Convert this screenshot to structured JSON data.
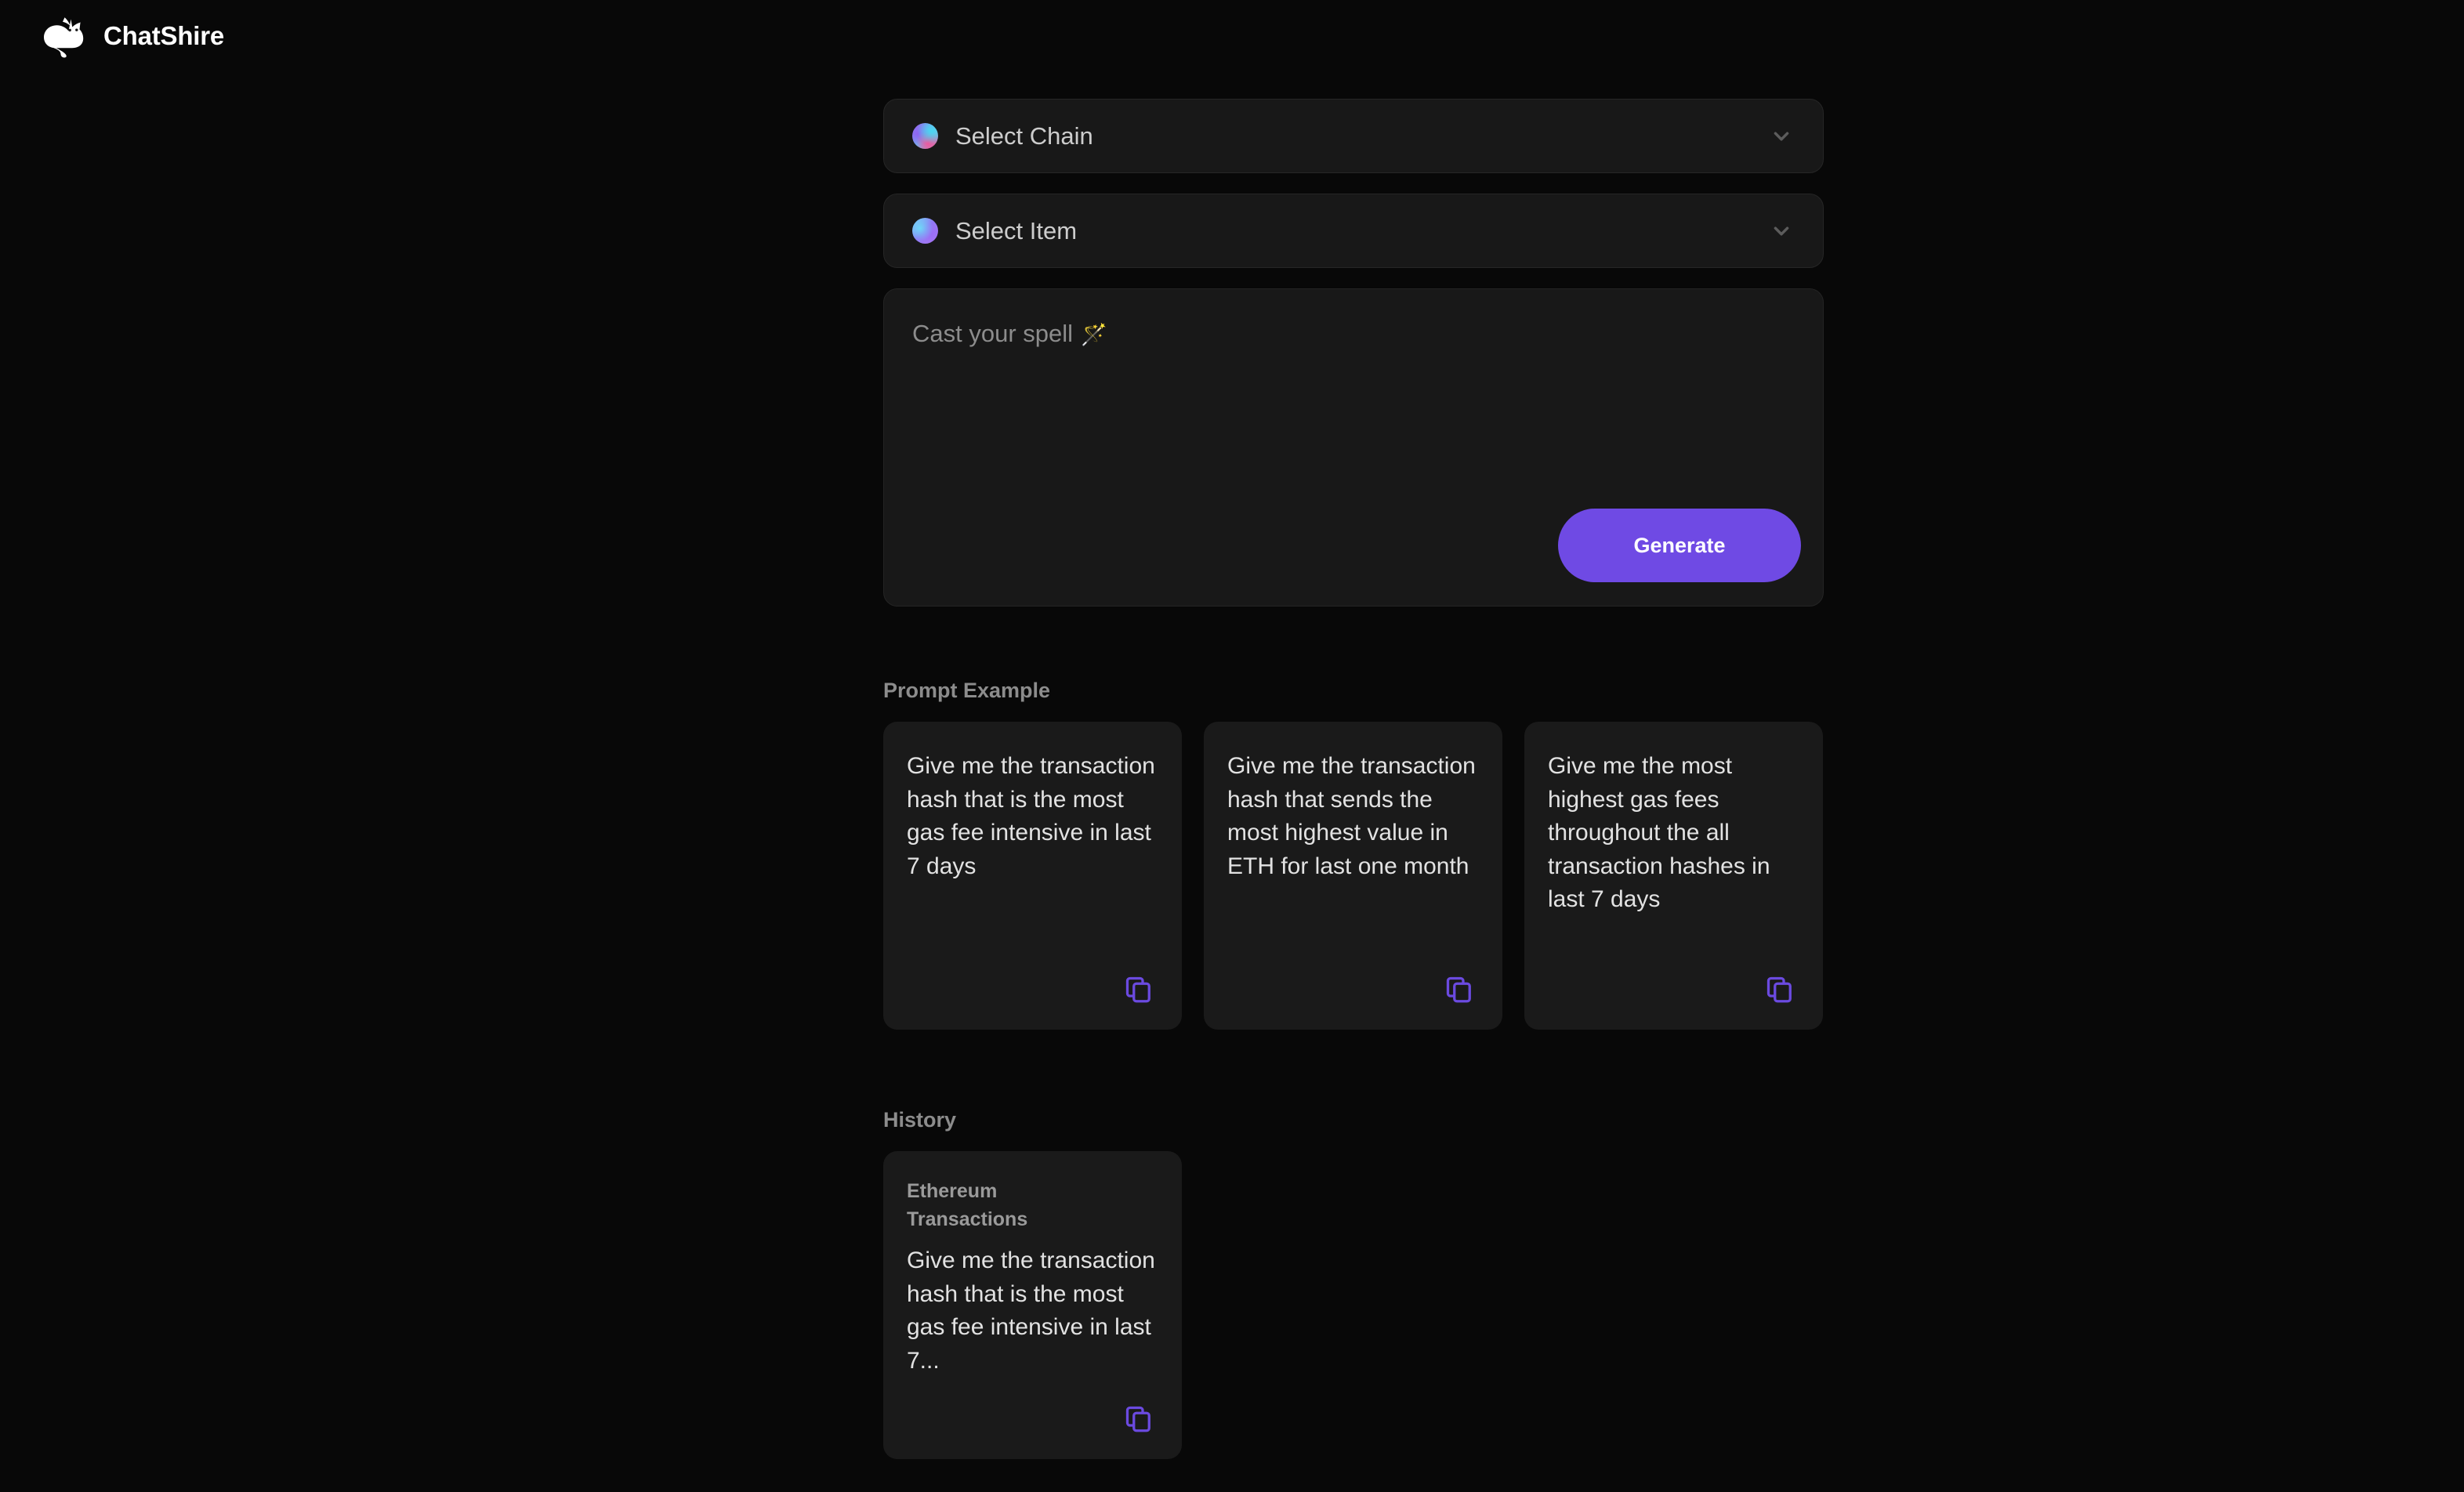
{
  "brand": {
    "name": "ChatShire",
    "logo_icon": "cat-logo-icon"
  },
  "selectors": [
    {
      "label": "Select Chain",
      "orb_icon": "gradient-orb-chain-icon",
      "chevron_icon": "chevron-down-icon"
    },
    {
      "label": "Select Item",
      "orb_icon": "gradient-orb-item-icon",
      "chevron_icon": "chevron-down-icon"
    }
  ],
  "composer": {
    "placeholder": "Cast your spell",
    "wand_emoji": "🪄",
    "generate_label": "Generate",
    "accent_color": "#6f4ae4"
  },
  "prompt_example": {
    "heading": "Prompt Example",
    "cards": [
      {
        "text": "Give me the transaction hash that is the most gas fee intensive in last 7 days",
        "copy_icon": "copy-icon"
      },
      {
        "text": "Give me the transaction hash that sends the most highest value in ETH for last one month",
        "copy_icon": "copy-icon"
      },
      {
        "text": "Give me the most highest gas fees throughout the all transaction hashes in last 7 days",
        "copy_icon": "copy-icon"
      }
    ]
  },
  "history": {
    "heading": "History",
    "cards": [
      {
        "chain": "Ethereum",
        "item": "Transactions",
        "text": "Give me the transaction hash that is the most gas fee intensive in last 7...",
        "copy_icon": "copy-icon"
      }
    ]
  },
  "colors": {
    "page_background": "#080808",
    "card_background": "#1a1a1a",
    "panel_background": "#181818",
    "accent_purple": "#6f4ae4",
    "copy_icon_purple": "#6b4ae0",
    "muted_text": "#8c8c8c",
    "body_text": "#e2e2e2"
  }
}
